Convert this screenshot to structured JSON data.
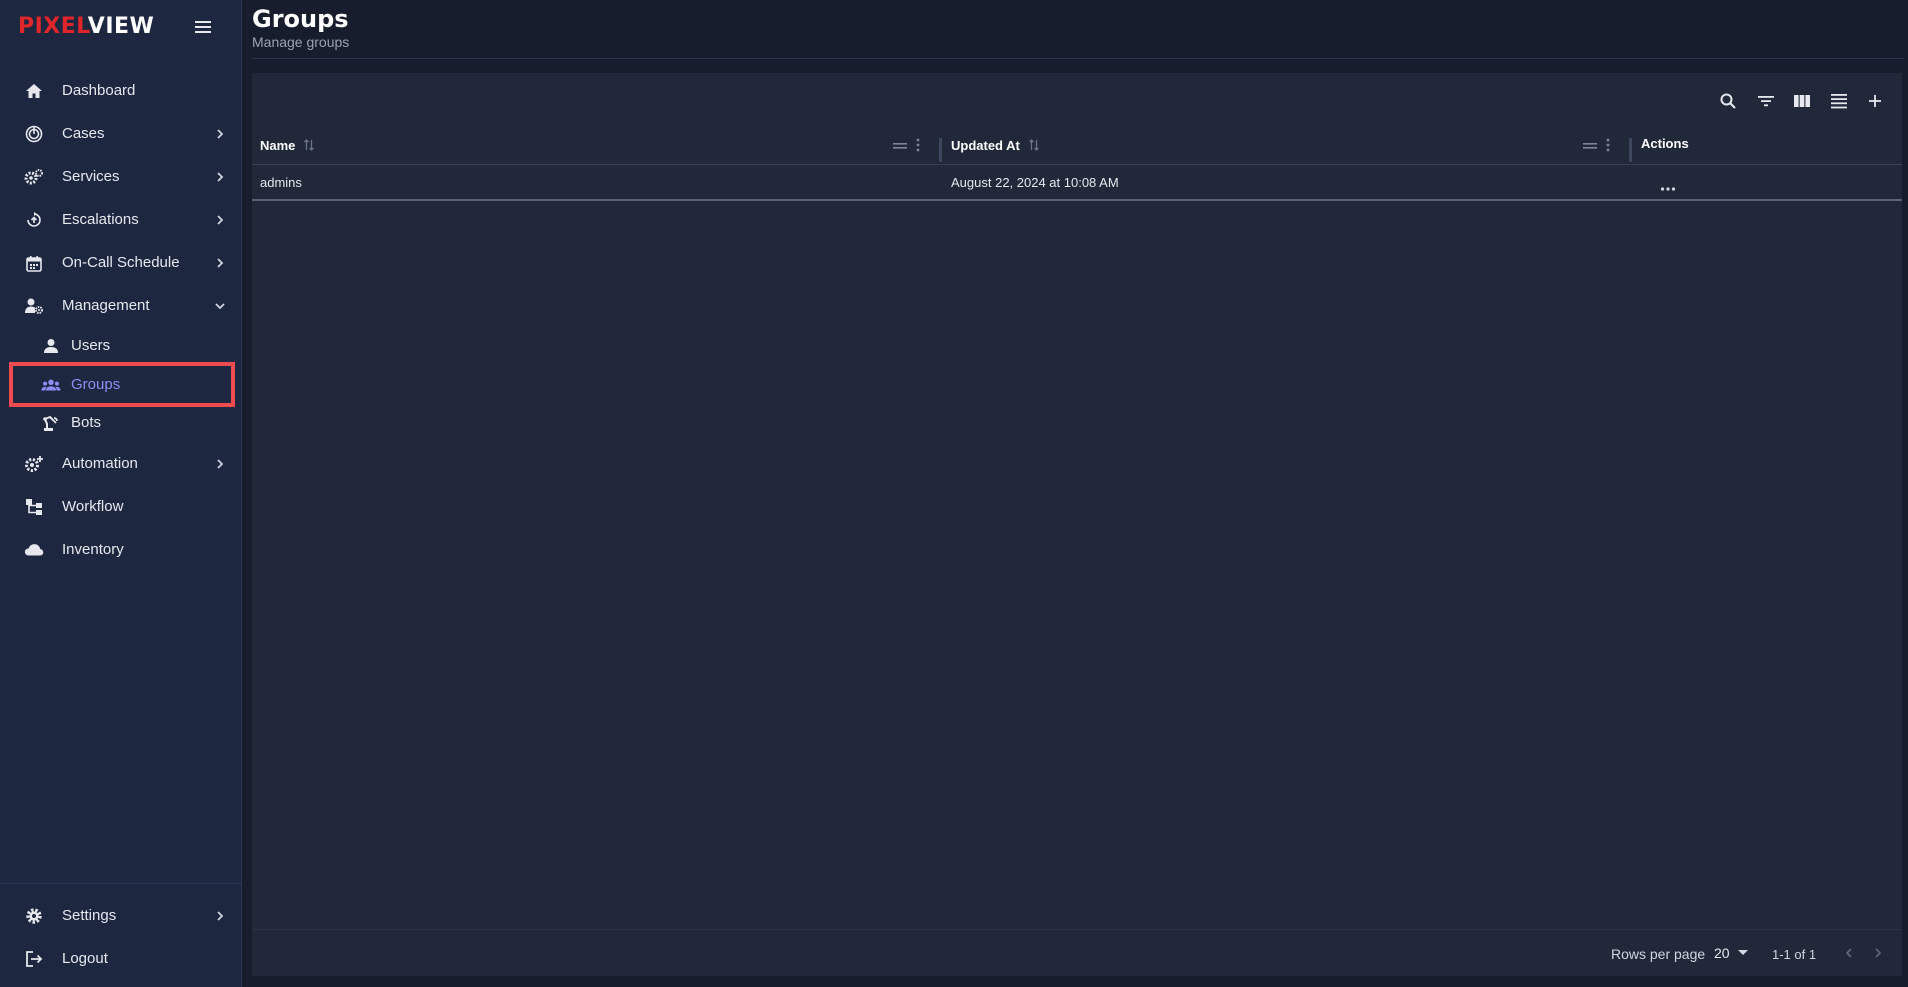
{
  "brand": {
    "part1": "PIXEL",
    "part2": "VIEW",
    "color1": "#e0262b",
    "color2": "#ffffff"
  },
  "sidebar": {
    "items": [
      {
        "label": "Dashboard",
        "icon": "home-icon",
        "has_chevron": false
      },
      {
        "label": "Cases",
        "icon": "fingerprint-icon",
        "has_chevron": true
      },
      {
        "label": "Services",
        "icon": "gears-icon",
        "has_chevron": true
      },
      {
        "label": "Escalations",
        "icon": "escalation-icon",
        "has_chevron": true
      },
      {
        "label": "On-Call Schedule",
        "icon": "calendar-icon",
        "has_chevron": true
      },
      {
        "label": "Management",
        "icon": "user-gear-icon",
        "has_chevron": true,
        "expanded": true
      },
      {
        "label": "Users",
        "icon": "person-icon",
        "sub": true
      },
      {
        "label": "Groups",
        "icon": "group-icon",
        "sub": true,
        "active": true
      },
      {
        "label": "Bots",
        "icon": "robot-arm-icon",
        "sub": true
      },
      {
        "label": "Automation",
        "icon": "gear-plus-icon",
        "has_chevron": true
      },
      {
        "label": "Workflow",
        "icon": "workflow-icon",
        "has_chevron": false
      },
      {
        "label": "Inventory",
        "icon": "cloud-icon",
        "has_chevron": false
      }
    ],
    "bottom_items": [
      {
        "label": "Settings",
        "icon": "gear-icon",
        "has_chevron": true
      },
      {
        "label": "Logout",
        "icon": "logout-icon",
        "has_chevron": false
      }
    ],
    "active_color": "#8f8df5",
    "highlight_color": "#ee4b50"
  },
  "header": {
    "title": "Groups",
    "subtitle": "Manage groups"
  },
  "toolbar": {
    "icons": [
      "search-icon",
      "filter-icon",
      "columns-icon",
      "density-icon",
      "add-icon"
    ]
  },
  "table": {
    "columns": [
      {
        "label": "Name",
        "sortable": true
      },
      {
        "label": "Updated At",
        "sortable": true
      },
      {
        "label": "Actions",
        "sortable": false
      }
    ],
    "rows": [
      {
        "name": "admins",
        "updated_at": "August 22, 2024 at 10:08 AM"
      }
    ]
  },
  "footer": {
    "rows_per_page_label": "Rows per page",
    "rows_per_page_value": "20",
    "range": "1-1 of 1"
  }
}
